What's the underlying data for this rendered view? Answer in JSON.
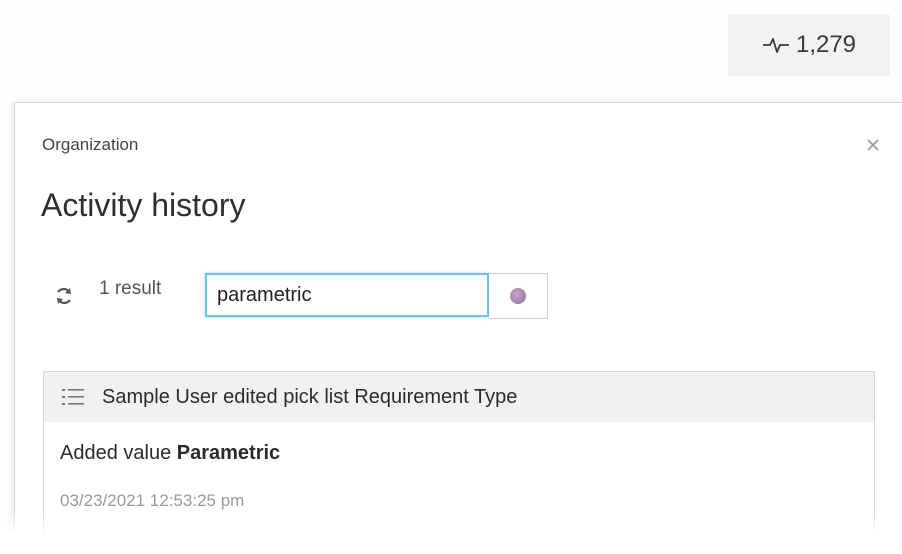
{
  "activity_counter": {
    "icon": "activity-pulse-icon",
    "count": "1,279"
  },
  "panel": {
    "subtitle": "Organization",
    "title": "Activity history",
    "close_icon": "close-icon"
  },
  "toolbar": {
    "refresh_icon": "refresh-icon",
    "result_count": "1 result",
    "search": {
      "value": "parametric",
      "placeholder": ""
    },
    "clear_icon": "clear-search-icon"
  },
  "activities": [
    {
      "icon": "list-icon",
      "summary": "Sample User edited pick list Requirement Type",
      "change_prefix": "Added value",
      "change_value": "Parametric",
      "timestamp": "03/23/2021 12:53:25 pm"
    }
  ],
  "colors": {
    "search_focus_border": "#6fc3e8",
    "card_header_bg": "#f1f1f1",
    "timestamp_text": "#9a9a9a"
  }
}
